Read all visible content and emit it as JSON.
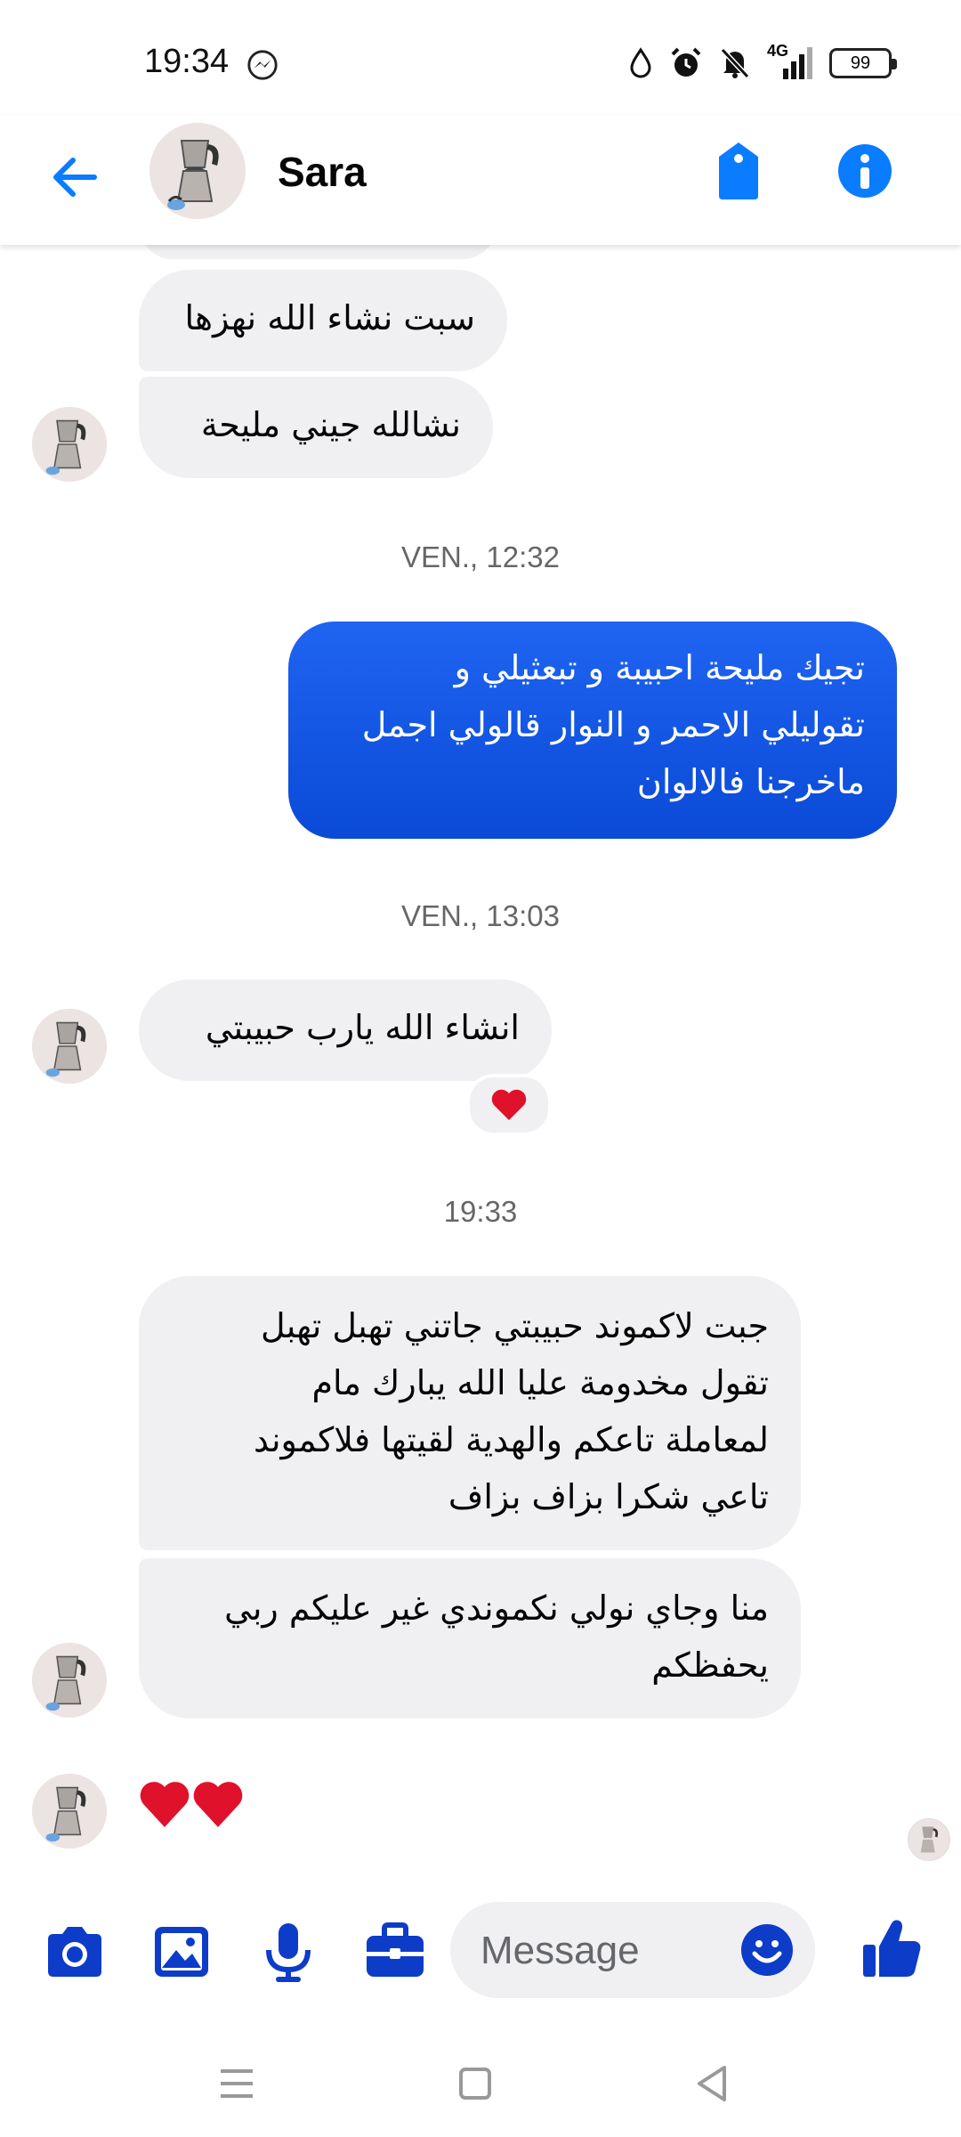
{
  "status_bar": {
    "time": "19:34",
    "network": "4G",
    "battery": "99",
    "icons": [
      "messenger-icon",
      "water-drop-icon",
      "alarm-icon",
      "bell-muted-icon",
      "signal-icon",
      "battery-icon"
    ]
  },
  "header": {
    "contact_name": "Sara",
    "icons": [
      "back-arrow-icon",
      "tag-icon",
      "info-icon"
    ]
  },
  "messages": [
    {
      "id": "m1",
      "direction": "incoming",
      "text": "سبت نشاء الله نهزها"
    },
    {
      "id": "m2",
      "direction": "incoming",
      "text": "نشالله جيني مليحة"
    },
    {
      "id": "t1",
      "type": "timestamp",
      "text": "VEN., 12:32"
    },
    {
      "id": "m3",
      "direction": "outgoing",
      "lines": [
        "تجيك مليحة احبيبة و تبعثيلي و",
        "تقوليلي الاحمر و النوار قالولي اجمل",
        "ماخرجنا فالالوان"
      ]
    },
    {
      "id": "t2",
      "type": "timestamp",
      "text": "VEN., 13:03"
    },
    {
      "id": "m4",
      "direction": "incoming",
      "text": "انشاء الله يارب حبيبتي",
      "reaction": "❤"
    },
    {
      "id": "t3",
      "type": "timestamp",
      "text": "19:33"
    },
    {
      "id": "m5",
      "direction": "incoming",
      "lines": [
        "جبت لاكموند حبيبتي جاتني تهبل تهبل",
        "تقول مخدومة عليا الله يبارك مام",
        "لمعاملة تاعكم والهدية لقيتها فلاكموند",
        "تاعي شكرا بزاف بزاف"
      ]
    },
    {
      "id": "m6",
      "direction": "incoming",
      "lines": [
        "منا وجاي نولي نكموندي غير عليكم ربي",
        "يحفظكم"
      ]
    },
    {
      "id": "m7",
      "direction": "incoming",
      "text": "❤❤"
    }
  ],
  "composer": {
    "placeholder": "Message",
    "icons": [
      "camera-icon",
      "gallery-icon",
      "microphone-icon",
      "briefcase-icon",
      "emoji-icon",
      "thumbs-up-icon"
    ]
  },
  "colors": {
    "accent": "#0a7cff",
    "outgoing_bubble": "#0b4fdc",
    "incoming_bubble": "#f0f0f2",
    "composer_icons": "#0d3cc8",
    "heart": "#e0112b"
  }
}
